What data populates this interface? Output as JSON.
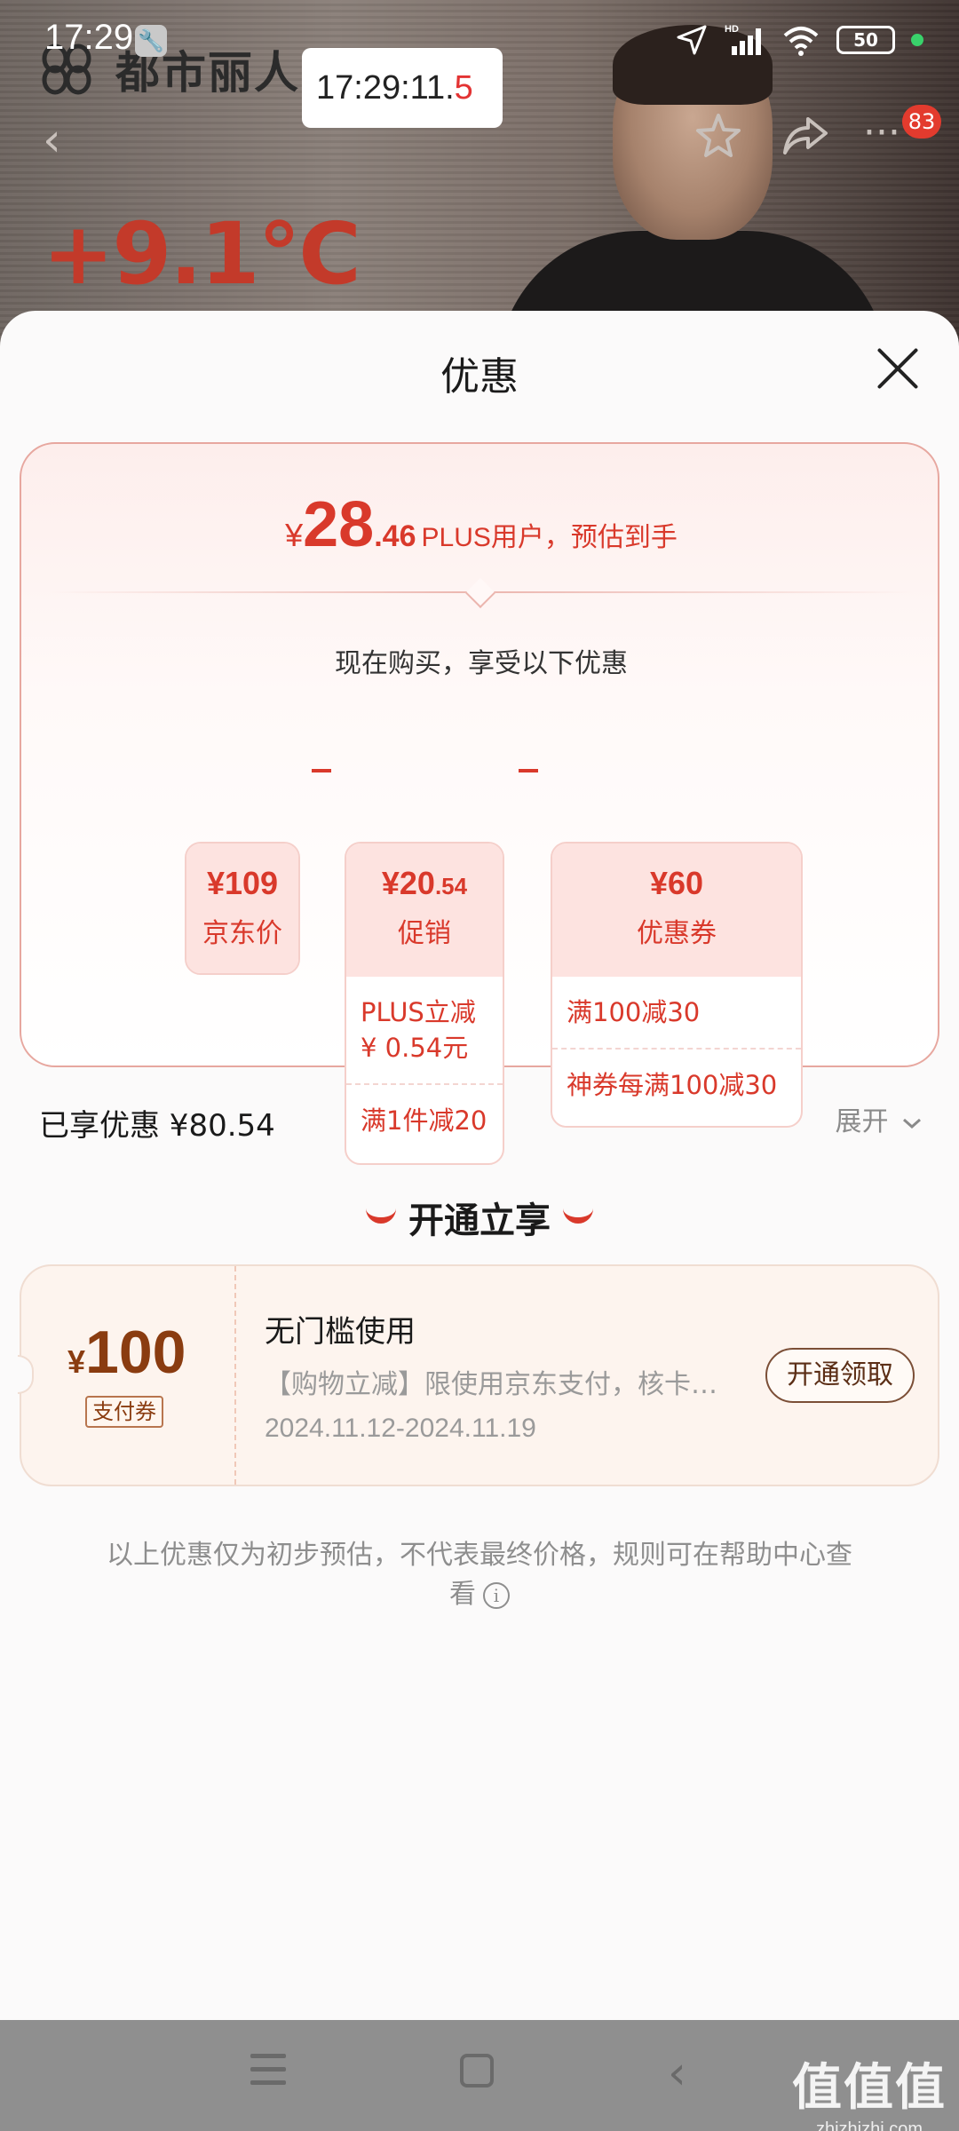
{
  "status_bar": {
    "time": "17:29",
    "battery": "50",
    "network": "HD"
  },
  "time_overlay": {
    "main": "17:29:11.",
    "tenths": "5"
  },
  "background": {
    "brand": "都市丽人",
    "temperature": "+9.1℃",
    "badge_count": "83"
  },
  "sheet": {
    "title": "优惠",
    "estimate": {
      "yen": "¥",
      "integer": "28",
      "decimal": ".46",
      "desc": "PLUS用户，预估到手"
    },
    "buy_now_title": "现在购买，享受以下优惠",
    "breakdown": {
      "jd_price": {
        "value": "¥109",
        "label": "京东价"
      },
      "promo": {
        "value_main": "¥20",
        "value_dec": ".54",
        "label": "促销",
        "items": [
          "PLUS立减 ¥ 0.54元",
          "满1件减20"
        ]
      },
      "coupon": {
        "value": "¥60",
        "label": "优惠券",
        "items": [
          "满100减30",
          "神券每满100减30"
        ]
      }
    },
    "enjoyed": "已享优惠 ¥80.54",
    "expand_label": "展开",
    "open_title": "开通立享",
    "offer": {
      "yen": "¥",
      "amount": "100",
      "tag": "支付券",
      "title": "无门槛使用",
      "desc": "【购物立减】限使用京东支付，核卡…",
      "date": "2024.11.12-2024.11.19",
      "button": "开通领取"
    },
    "disclaimer": "以上优惠仅为初步预估，不代表最终价格，规则可在帮助中心查看"
  },
  "watermark": {
    "main": "值值值",
    "sub": "zhizhizhi.com"
  },
  "colors": {
    "accent": "#d9392b",
    "coupon_brown": "#8a3c10",
    "card_border": "#e7a79f"
  }
}
